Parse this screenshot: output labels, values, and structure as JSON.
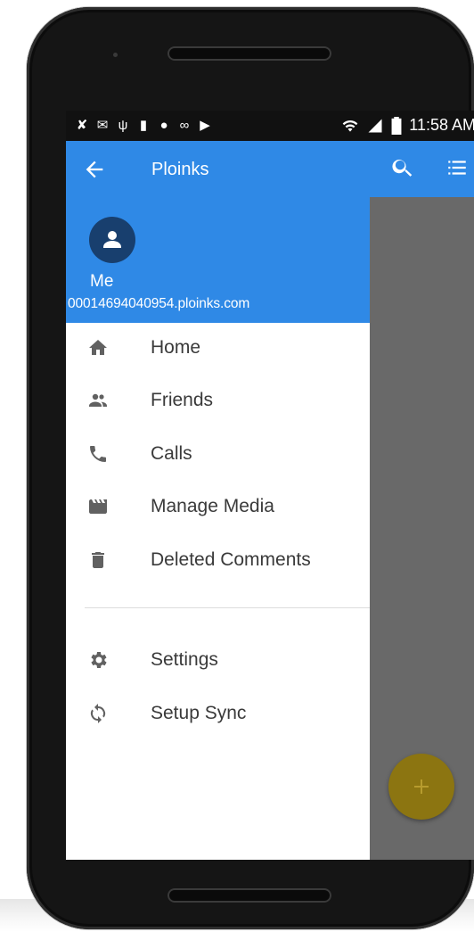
{
  "status_bar": {
    "time": "11:58 AM",
    "notification_icons": [
      "missed-call-icon",
      "mail-icon",
      "usb-icon",
      "sd-card-icon",
      "evernote-icon",
      "voicemail-icon",
      "media-icon"
    ],
    "right_icons": [
      "wifi-icon",
      "signal-icon",
      "battery-icon"
    ]
  },
  "app_bar": {
    "title": "Ploinks",
    "icons": [
      "back-arrow-icon",
      "search-icon",
      "list-icon"
    ]
  },
  "drawer": {
    "user_name": "Me",
    "user_email": "00014694040954.ploinks.com",
    "items": [
      {
        "label": "Home",
        "icon": "home-icon"
      },
      {
        "label": "Friends",
        "icon": "people-icon"
      },
      {
        "label": "Calls",
        "icon": "phone-icon"
      },
      {
        "label": "Manage Media",
        "icon": "clapperboard-icon"
      },
      {
        "label": "Deleted Comments",
        "icon": "trash-icon"
      },
      {
        "label": "Settings",
        "icon": "gear-icon"
      },
      {
        "label": "Setup Sync",
        "icon": "sync-icon"
      }
    ]
  },
  "fab": {
    "icon": "plus-icon"
  },
  "colors": {
    "primary": "#2f89e6",
    "avatar_bg": "#183f6e",
    "scrim": "#696969",
    "fab": "#8c7511",
    "icon_gray": "#616161"
  }
}
